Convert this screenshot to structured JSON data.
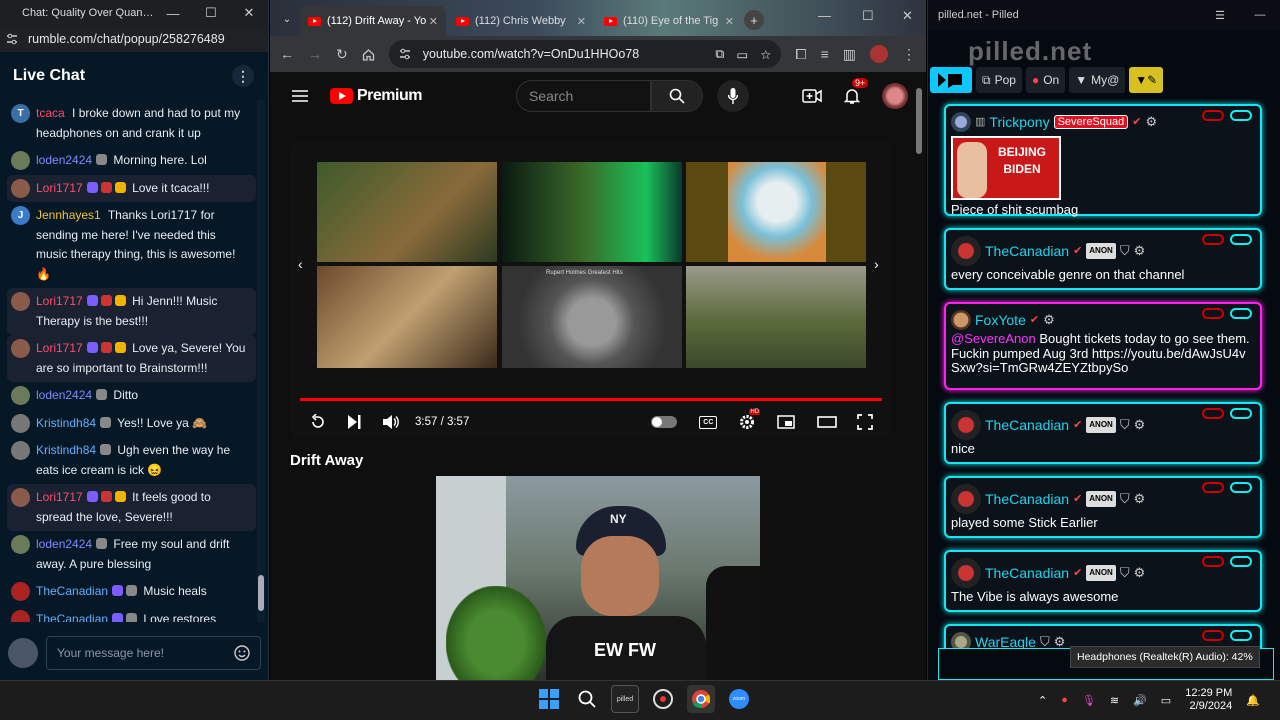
{
  "rumble": {
    "window_title": "Chat: Quality Over Quantity...",
    "url": "rumble.com/chat/popup/258276489",
    "header": "Live Chat",
    "input_placeholder": "Your message here!",
    "messages": [
      {
        "user": "tcaca",
        "text": "I broke down and had to put my headphones on and crank it up",
        "color": "#ff4d6d",
        "av": "T",
        "avbg": "#3a6ea5"
      },
      {
        "user": "loden2424",
        "text": "Morning here. Lol",
        "color": "#7d8cff",
        "av": "",
        "avbg": "#6b7a5a"
      },
      {
        "user": "Lori1717",
        "text": "Love it tcaca!!!",
        "color": "#ff4d6d",
        "av": "",
        "avbg": "#8a5a4a"
      },
      {
        "user": "Jennhayes1",
        "text": "Thanks Lori1717 for sending me here! I've needed this music therapy thing, this is awesome! 🔥",
        "color": "#f0c23a",
        "av": "J",
        "avbg": "#3a7cc8"
      },
      {
        "user": "Lori1717",
        "text": "Hi Jenn!!! Music Therapy is the best!!!",
        "color": "#ff4d6d",
        "av": "",
        "avbg": "#8a5a4a"
      },
      {
        "user": "Lori1717",
        "text": "Love ya, Severe! You are so important to Brainstorm!!!",
        "color": "#ff4d6d",
        "av": "",
        "avbg": "#8a5a4a"
      },
      {
        "user": "loden2424",
        "text": "Ditto",
        "color": "#7d8cff",
        "av": "",
        "avbg": "#6b7a5a"
      },
      {
        "user": "Kristindh84",
        "text": "Yes!! Love ya 🙈",
        "color": "#5fb0ff",
        "av": "",
        "avbg": "#777"
      },
      {
        "user": "Kristindh84",
        "text": "Ugh even the way he eats ice cream is ick 😖",
        "color": "#5fb0ff",
        "av": "",
        "avbg": "#777"
      },
      {
        "user": "Lori1717",
        "text": "It feels good to spread the love, Severe!!!",
        "color": "#ff4d6d",
        "av": "",
        "avbg": "#8a5a4a"
      },
      {
        "user": "loden2424",
        "text": "Free my soul and drift away. A pure blessing",
        "color": "#7d8cff",
        "av": "",
        "avbg": "#6b7a5a"
      },
      {
        "user": "TheCanadian",
        "text": "Music heals",
        "color": "#5fb0ff",
        "av": "",
        "avbg": "#a22"
      },
      {
        "user": "TheCanadian",
        "text": "Love restores",
        "color": "#5fb0ff",
        "av": "",
        "avbg": "#a22"
      }
    ]
  },
  "chrome": {
    "tabs": [
      {
        "label": "(112) Drift Away - Yo"
      },
      {
        "label": "(112) Chris Webby"
      },
      {
        "label": "(110) Eye of the Tig"
      }
    ],
    "url": "youtube.com/watch?v=OnDu1HHOo78",
    "yt": {
      "brand": "Premium",
      "search_placeholder": "Search",
      "notif_count": "9+",
      "time": "3:57 / 3:57",
      "video_title": "Drift Away",
      "thumb_caption": "Rupert Holmes Greatest Hits",
      "cam_cap": "NY",
      "shirt": "EW FW"
    }
  },
  "pilled": {
    "window_title": "pilled.net - Pilled",
    "logo": "pilled.net",
    "toolbar": {
      "pop": "Pop",
      "on": "On",
      "my": "My@"
    },
    "posts": [
      {
        "user": "Trickpony",
        "tag": "SevereSquad",
        "text": "Piece of shit scumbag",
        "image_text": "BEIJING BIDEN"
      },
      {
        "user": "TheCanadian",
        "text": "every conceivable genre on that channel"
      },
      {
        "user": "FoxYote",
        "mention": "@SevereAnon",
        "text": "Bought tickets today to go see them. Fuckin pumped Aug 3rd https://youtu.be/dAwJsU4vSxw?si=TmGRw4ZEYZtbpySo"
      },
      {
        "user": "TheCanadian",
        "text": "nice"
      },
      {
        "user": "TheCanadian",
        "text": "played some Stick Earlier"
      },
      {
        "user": "TheCanadian",
        "text": "The Vibe is always awesome"
      },
      {
        "user": "WarEagle",
        "text": ""
      }
    ],
    "anon_label": "ANON",
    "tooltip": "Headphones (Realtek(R) Audio): 42%"
  },
  "taskbar": {
    "time": "12:29 PM",
    "date": "2/9/2024"
  }
}
